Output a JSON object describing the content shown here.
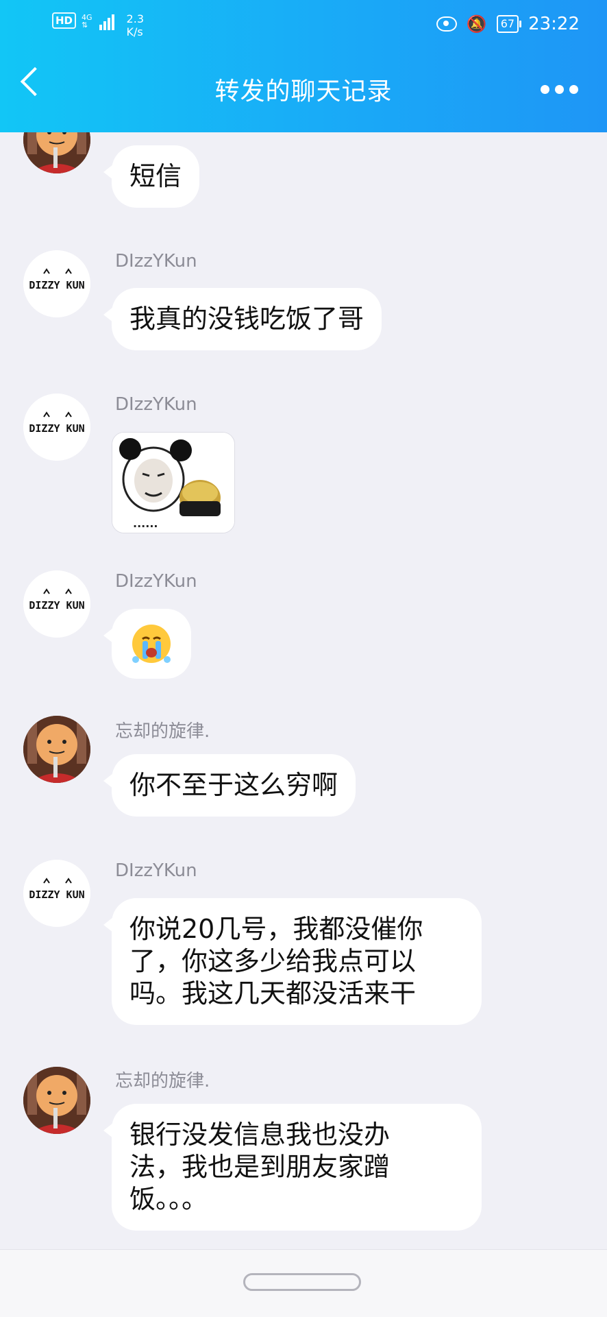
{
  "status_bar": {
    "hd": "HD",
    "network": "4G",
    "net_speed_value": "2.3",
    "net_speed_unit": "K/s",
    "battery": "67",
    "time": "23:22",
    "icons": [
      "eye-icon",
      "mute-icon",
      "battery-icon"
    ]
  },
  "header": {
    "title": "转发的聊天记录",
    "back_icon": "chevron-left-icon",
    "more_icon": "more-dots-icon"
  },
  "messages": [
    {
      "sender": "",
      "avatar": "cartoon-avatar",
      "type": "text",
      "text": "短信"
    },
    {
      "sender": "DIzzYKun",
      "avatar": "dizzykun-avatar",
      "type": "text",
      "text": "我真的没钱吃饭了哥"
    },
    {
      "sender": "DIzzYKun",
      "avatar": "dizzykun-avatar",
      "type": "image",
      "image": "panda-meme-sticker",
      "caption": "......"
    },
    {
      "sender": "DIzzYKun",
      "avatar": "dizzykun-avatar",
      "type": "emoji",
      "emoji": "😭"
    },
    {
      "sender": "忘却的旋律.",
      "avatar": "cartoon-avatar",
      "type": "text",
      "text": "你不至于这么穷啊"
    },
    {
      "sender": "DIzzYKun",
      "avatar": "dizzykun-avatar",
      "type": "text",
      "lines": [
        "你说20几号，我都没催你",
        "了，你这多少给我点可以",
        "吗。我这几天都没活来干"
      ]
    },
    {
      "sender": "忘却的旋律.",
      "avatar": "cartoon-avatar",
      "type": "text",
      "lines": [
        "银行没发信息我也没办",
        "法，我也是到朋友家蹭",
        "饭。。。"
      ]
    }
  ],
  "dizzy_logo_text": "DIZZY KUN",
  "colors": {
    "header_gradient_start": "#12c6f6",
    "header_gradient_end": "#1e96f6",
    "background": "#f0f0f6",
    "bubble": "#ffffff",
    "sender_name": "#8c8c96"
  }
}
